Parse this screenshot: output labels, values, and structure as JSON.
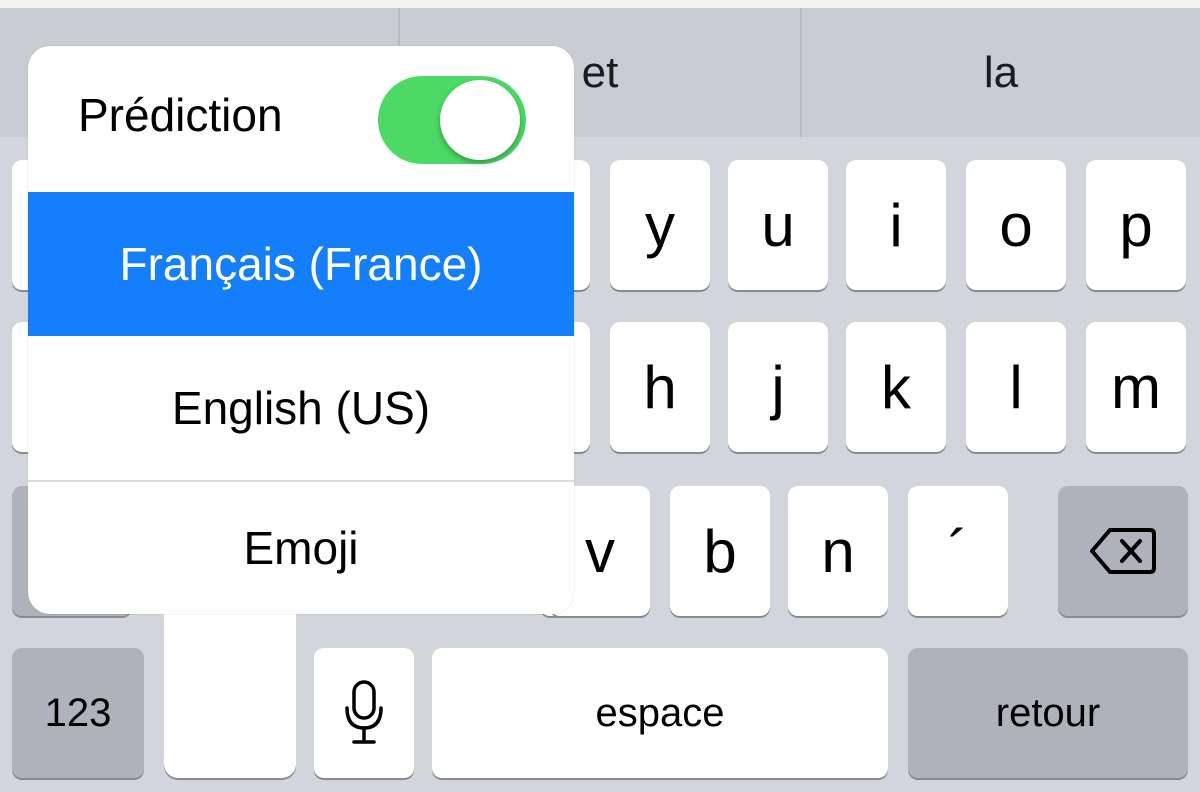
{
  "suggestions": [
    "",
    "et",
    "la"
  ],
  "keys": {
    "row1": [
      "y",
      "u",
      "i",
      "o",
      "p"
    ],
    "row2": [
      "h",
      "j",
      "k",
      "l",
      "m"
    ],
    "row3": [
      "v",
      "b",
      "n",
      "´"
    ],
    "numbers": "123",
    "space": "espace",
    "return": "retour"
  },
  "icons": {
    "delete": "backspace-icon",
    "mic": "microphone-icon"
  },
  "popup": {
    "prediction_label": "Prédiction",
    "prediction_on": true,
    "languages": [
      "Français (France)",
      "English (US)",
      "Emoji"
    ],
    "selected_language": "Français (France)"
  },
  "colors": {
    "accent": "#147efb",
    "toggle_on": "#4cd964",
    "keyboard_bg": "#d2d5db",
    "dark_key": "#adb2bb"
  }
}
